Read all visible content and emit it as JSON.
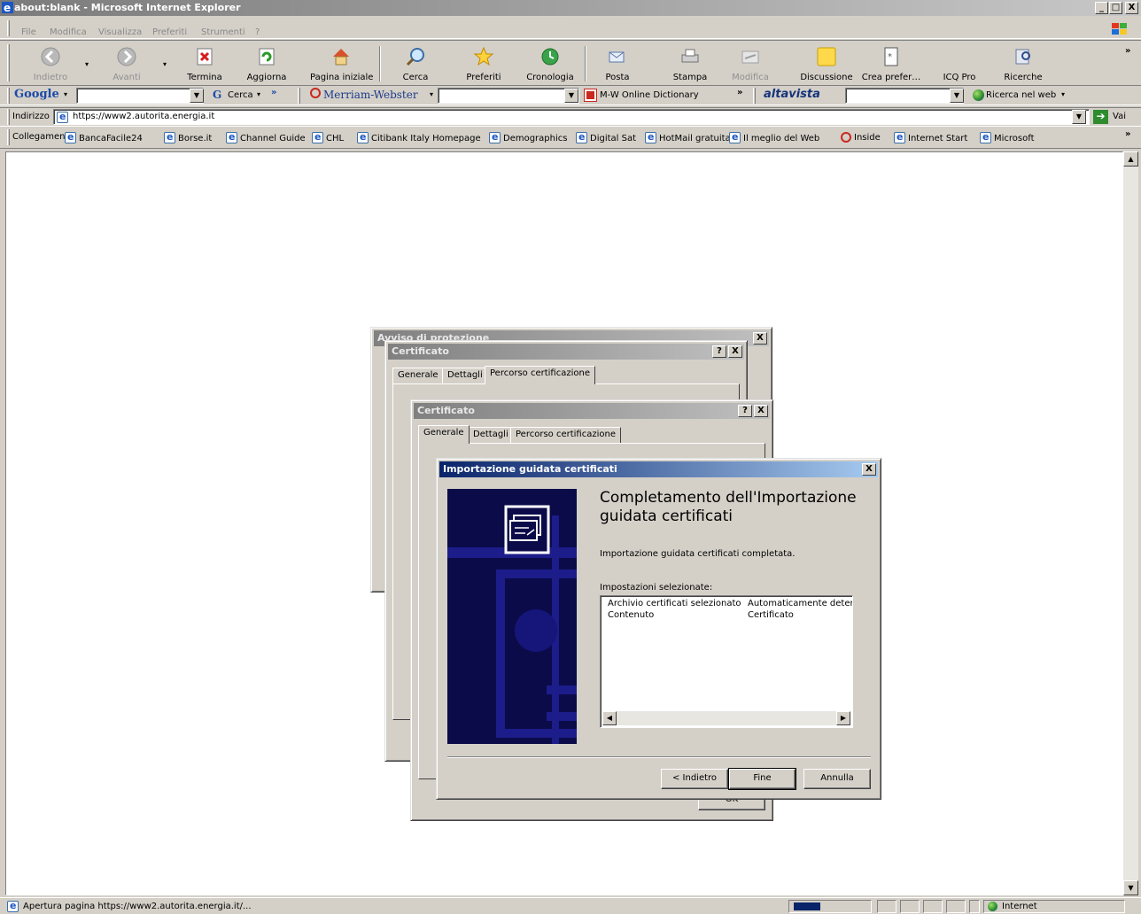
{
  "window": {
    "title": "about:blank - Microsoft Internet Explorer",
    "minimize": "_",
    "maximize": "□",
    "close": "X"
  },
  "menu": [
    "File",
    "Modifica",
    "Visualizza",
    "Preferiti",
    "Strumenti",
    "?"
  ],
  "toolbar": {
    "back": "Indietro",
    "forward": "Avanti",
    "stop": "Termina",
    "refresh": "Aggiorna",
    "home": "Pagina iniziale",
    "search": "Cerca",
    "favorites": "Preferiti",
    "history": "Cronologia",
    "mail": "Posta",
    "print": "Stampa",
    "edit": "Modifica",
    "discuss": "Discussione",
    "create_pref": "Crea prefer…",
    "icq": "ICQ Pro",
    "research": "Ricerche",
    "more": "»"
  },
  "searchbar": {
    "google": "Google",
    "google_search": "Cerca",
    "google_more": "»",
    "merriam": "Merriam-Webster",
    "mw_dictionary": "M-W Online Dictionary",
    "altavista": "altavista",
    "web_search": "Ricerca nel web",
    "more": "»"
  },
  "address": {
    "label": "Indirizzo",
    "url": "https://www2.autorita.energia.it",
    "go": "Vai"
  },
  "links": {
    "label": "Collegamenti",
    "items": [
      "BancaFacile24",
      "Borse.it",
      "Channel Guide",
      "CHL",
      "Citibank Italy Homepage",
      "Demographics",
      "Digital Sat",
      "HotMail gratuita",
      "Il meglio del Web",
      "Inside",
      "Internet Start",
      "Microsoft"
    ],
    "more": "»"
  },
  "status": {
    "text": "Apertura pagina https://www2.autorita.energia.it/...",
    "zone": "Internet"
  },
  "security_dialog": {
    "title": "Avviso di protezione",
    "close": "X"
  },
  "cert_dialog_1": {
    "title": "Certificato",
    "help": "?",
    "close": "X",
    "tabs": [
      "Generale",
      "Dettagli",
      "Percorso certificazione"
    ]
  },
  "cert_dialog_2": {
    "title": "Certificato",
    "help": "?",
    "close": "X",
    "tabs": [
      "Generale",
      "Dettagli",
      "Percorso certificazione"
    ],
    "ok": "OK"
  },
  "wizard": {
    "title": "Importazione guidata certificati",
    "close": "X",
    "heading": "Completamento dell'Importazione guidata certificati",
    "completed_text": "Importazione guidata certificati completata.",
    "settings_label": "Impostazioni selezionate:",
    "settings": [
      {
        "key": "Archivio certificati selezionato",
        "value": "Automaticamente determi"
      },
      {
        "key": "Contenuto",
        "value": "Certificato"
      }
    ],
    "back": "< Indietro",
    "finish": "Fine",
    "cancel": "Annulla"
  }
}
